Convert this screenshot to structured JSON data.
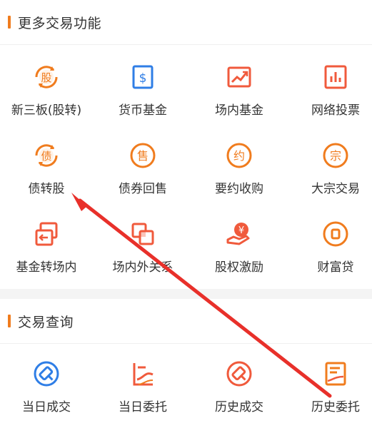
{
  "more_section": {
    "title": "更多交易功能",
    "items": [
      {
        "label": "新三板(股转)",
        "glyph": "股",
        "icon": "stock-transfer-icon"
      },
      {
        "label": "货币基金",
        "glyph": "$",
        "icon": "dollar-fund-icon"
      },
      {
        "label": "场内基金",
        "glyph": "",
        "icon": "trend-chart-icon"
      },
      {
        "label": "网络投票",
        "glyph": "",
        "icon": "bar-chart-icon"
      },
      {
        "label": "债转股",
        "glyph": "债",
        "icon": "bond-convert-icon"
      },
      {
        "label": "债券回售",
        "glyph": "售",
        "icon": "bond-sellback-icon"
      },
      {
        "label": "要约收购",
        "glyph": "约",
        "icon": "tender-offer-icon"
      },
      {
        "label": "大宗交易",
        "glyph": "宗",
        "icon": "block-trade-icon"
      },
      {
        "label": "基金转场内",
        "glyph": "",
        "icon": "fund-transfer-icon"
      },
      {
        "label": "场内外关系",
        "glyph": "",
        "icon": "on-off-relation-icon"
      },
      {
        "label": "股权激励",
        "glyph": "¥",
        "icon": "equity-incentive-icon"
      },
      {
        "label": "财富贷",
        "glyph": "",
        "icon": "wealth-loan-icon"
      }
    ]
  },
  "query_section": {
    "title": "交易查询",
    "items": [
      {
        "label": "当日成交",
        "icon": "today-deals-icon"
      },
      {
        "label": "当日委托",
        "icon": "today-orders-icon"
      },
      {
        "label": "历史成交",
        "icon": "history-deals-icon"
      },
      {
        "label": "历史委托",
        "icon": "history-orders-icon"
      }
    ]
  },
  "colors": {
    "orange": "#f07c1e",
    "red": "#f05a3c",
    "blue": "#2f7ee6",
    "arrow_red": "#e8302a"
  }
}
